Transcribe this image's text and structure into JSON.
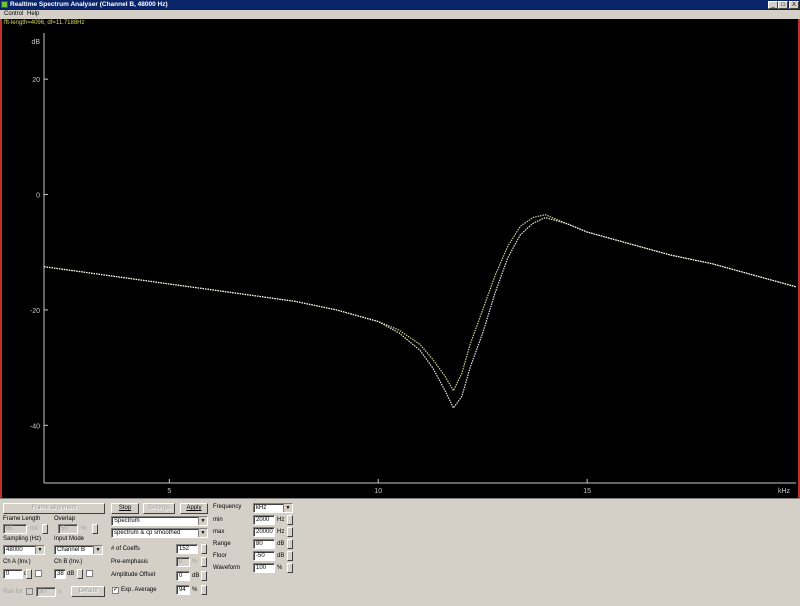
{
  "window": {
    "title": "Realtime Spectrum Analyser (Channel B, 48000 Hz)",
    "controls": [
      "_",
      "□",
      "X"
    ]
  },
  "menu": [
    "Control",
    "Help"
  ],
  "plot": {
    "info": "fft-length=4096, df=11.7188Hz",
    "y_unit": "dB",
    "x_unit": "kHz",
    "y_ticks": [
      "20",
      "0",
      "-20",
      "-40"
    ],
    "x_ticks": [
      "5",
      "10",
      "15"
    ]
  },
  "chart_data": {
    "type": "line",
    "xlabel": "kHz",
    "ylabel": "dB",
    "xlim": [
      2,
      20
    ],
    "ylim": [
      -50,
      28
    ],
    "grid": false,
    "legend": "none",
    "series": [
      {
        "color": "#e8e8a0",
        "x": [
          2,
          3,
          4,
          5,
          6,
          7,
          8,
          9,
          10,
          10.5,
          11,
          11.3,
          11.6,
          11.8,
          12.0,
          12.2,
          12.5,
          12.8,
          13.1,
          13.4,
          13.7,
          14.0,
          14.5,
          15,
          16,
          17,
          18,
          19,
          20
        ],
        "y": [
          -12.5,
          -13.5,
          -14.5,
          -15.5,
          -16.5,
          -17.5,
          -18.5,
          -20,
          -22,
          -23.5,
          -26,
          -28.5,
          -31.5,
          -34,
          -31,
          -26,
          -20,
          -14,
          -9,
          -5.5,
          -4,
          -3.5,
          -5,
          -6.5,
          -8.5,
          -10.5,
          -12,
          -14,
          -16
        ]
      },
      {
        "color": "#ffffff",
        "x": [
          2,
          3,
          4,
          5,
          6,
          7,
          8,
          9,
          10,
          10.5,
          11,
          11.3,
          11.6,
          11.8,
          12.0,
          12.2,
          12.5,
          12.8,
          13.1,
          13.4,
          13.7,
          14.0,
          14.5,
          15,
          16,
          17,
          18,
          19,
          20
        ],
        "y": [
          -12.5,
          -13.5,
          -14.5,
          -15.5,
          -16.5,
          -17.5,
          -18.5,
          -20,
          -22,
          -24,
          -27,
          -30,
          -34,
          -37,
          -35,
          -30,
          -24,
          -17,
          -11,
          -7,
          -5,
          -4,
          -5,
          -6.5,
          -8.5,
          -10.5,
          -12,
          -14,
          -16
        ]
      }
    ]
  },
  "left_panel": {
    "frame_alignment_label": "Frame alignment",
    "frame_length_label": "Frame Length",
    "frame_length_value": "85",
    "frame_length_unit": "ms",
    "overlap_label": "Overlap",
    "overlap_value": "50",
    "overlap_unit": "%",
    "sampling_label": "Sampling (Hz)",
    "sampling_value": "48000",
    "input_mode_label": "Input Mode",
    "input_mode_value": "Channel B",
    "ch_a_label": "Ch A (Inv.)",
    "ch_a_value": "0",
    "ch_a_unit": "dB",
    "ch_b_label": "Ch B (Inv.)",
    "ch_b_value": "38",
    "ch_b_unit": "dB",
    "run_for_label": "Run for",
    "run_for_value": "30",
    "run_for_unit": "s",
    "default_label": "Default"
  },
  "middle_panel": {
    "stop_label": "Stop",
    "settings_label": "Settings",
    "apply_label": "Apply",
    "display_mode": "Spectrum",
    "smoothing_mode": "spectrum & cp smoothed",
    "coeffs_label": "# of Coeffs",
    "coeffs_value": "152",
    "pre_emphasis_label": "Pre-emphasis",
    "pre_emphasis_value": "0",
    "pre_emphasis_unit": "%",
    "amplitude_offset_label": "Amplitude Offset",
    "amplitude_offset_value": "0",
    "amplitude_offset_unit": "dB",
    "exp_average_label": "Exp. Average",
    "exp_average_checked": "✓",
    "exp_average_value": "94",
    "exp_average_unit": "%"
  },
  "right_panel": {
    "frequency_label": "Frequency",
    "frequency_unit_value": "kHz",
    "min_label": "min",
    "min_value": "2000",
    "min_unit": "Hz",
    "max_label": "max",
    "max_value": "20000",
    "max_unit": "Hz",
    "range_label": "Range",
    "range_value": "80",
    "range_unit": "dB",
    "floor_label": "Floor",
    "floor_value": "-50",
    "floor_unit": "dB",
    "waveform_label": "Waveform",
    "waveform_value": "100",
    "waveform_unit": "%"
  }
}
